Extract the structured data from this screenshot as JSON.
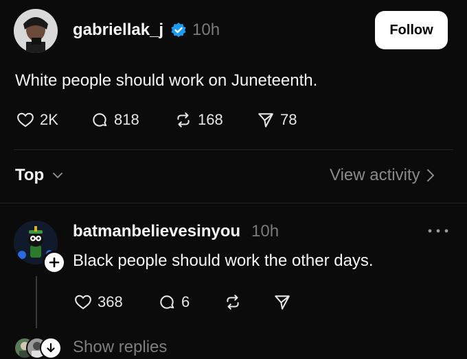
{
  "post": {
    "username": "gabriellak_j",
    "time": "10h",
    "verified_icon": "verified-badge-icon",
    "follow_label": "Follow",
    "text": "White people should work on Juneteenth.",
    "likes": "2K",
    "comments": "818",
    "reposts": "168",
    "shares": "78"
  },
  "sort": {
    "label": "Top",
    "view_activity": "View activity"
  },
  "reply": {
    "username": "batmanbelievesinyou",
    "time": "10h",
    "text": "Black people should work the other days.",
    "likes": "368",
    "comments": "6",
    "show_replies": "Show replies"
  },
  "colors": {
    "background": "#0b0b0b",
    "verified": "#1d9bf0",
    "muted": "#7a7a7a"
  }
}
